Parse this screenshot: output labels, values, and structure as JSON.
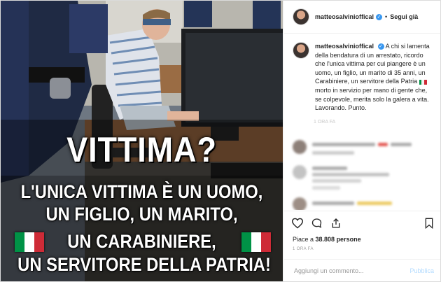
{
  "post": {
    "username": "matteosalvinioffical",
    "follow_label": "Segui già",
    "caption_username": "matteosalvinioffical",
    "caption_part1": "A chi si lamenta della bendatura di un arrestato, ricordo che l'unica vittima per cui piangere è un uomo, un figlio, un marito di 35 anni, un Carabiniere, un servitore della Patria",
    "caption_part2": " morto in servizio per mano di gente che, se colpevole, merita solo la galera a vita. Lavorando. Punto.",
    "caption_time": "1 ORA FA",
    "likes_prefix": "Piace a ",
    "likes_count": "38.808",
    "likes_suffix": " persone",
    "post_time": "1 ORA FA",
    "comment_placeholder": "Aggiungi un commento...",
    "publish_label": "Pubblica"
  },
  "poster": {
    "title": "VITTIMA?",
    "line1": "L'UNICA VITTIMA È UN UOMO,",
    "line2": "UN FIGLIO, UN MARITO,",
    "line3": "UN CARABINIERE,",
    "line4": "UN SERVITORE DELLA PATRIA!"
  },
  "colors": {
    "flag_green": "#009246",
    "flag_white": "#ffffff",
    "flag_red": "#ce2b37",
    "verified_blue": "#3897f0",
    "publish_disabled": "#b3dbff"
  },
  "icons": [
    "heart-icon",
    "comment-icon",
    "share-icon",
    "bookmark-icon",
    "verified-icon",
    "flag-italy-icon"
  ]
}
